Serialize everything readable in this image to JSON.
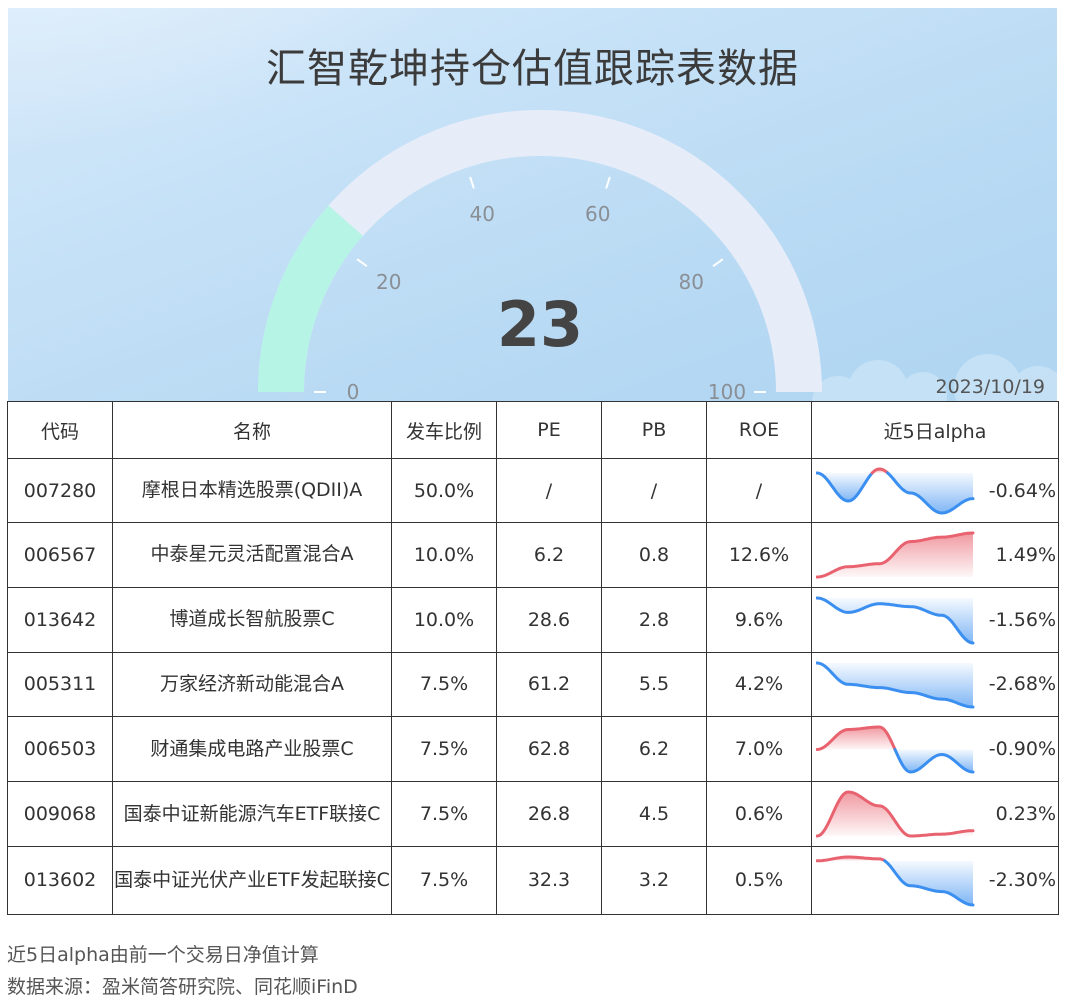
{
  "title": "汇智乾坤持仓估值跟踪表数据",
  "date": "2023/10/19",
  "gauge": {
    "value": 23,
    "min": 0,
    "max": 100,
    "ticks": [
      "0",
      "20",
      "40",
      "60",
      "80",
      "100"
    ],
    "fill_color": "#b6f4e6",
    "track_color": "#e6ecf8"
  },
  "table": {
    "headers": [
      "代码",
      "名称",
      "发车比例",
      "PE",
      "PB",
      "ROE",
      "近5日alpha"
    ],
    "rows": [
      {
        "code": "007280",
        "name": "摩根日本精选股票(QDII)A",
        "ratio": "50.0%",
        "pe": "/",
        "pb": "/",
        "roe": "/",
        "alpha": "-0.64%"
      },
      {
        "code": "006567",
        "name": "中泰星元灵活配置混合A",
        "ratio": "10.0%",
        "pe": "6.2",
        "pb": "0.8",
        "roe": "12.6%",
        "alpha": "1.49%"
      },
      {
        "code": "013642",
        "name": "博道成长智航股票C",
        "ratio": "10.0%",
        "pe": "28.6",
        "pb": "2.8",
        "roe": "9.6%",
        "alpha": "-1.56%"
      },
      {
        "code": "005311",
        "name": "万家经济新动能混合A",
        "ratio": "7.5%",
        "pe": "61.2",
        "pb": "5.5",
        "roe": "4.2%",
        "alpha": "-2.68%"
      },
      {
        "code": "006503",
        "name": "财通集成电路产业股票C",
        "ratio": "7.5%",
        "pe": "62.8",
        "pb": "6.2",
        "roe": "7.0%",
        "alpha": "-0.90%"
      },
      {
        "code": "009068",
        "name": "国泰中证新能源汽车ETF联接C",
        "ratio": "7.5%",
        "pe": "26.8",
        "pb": "4.5",
        "roe": "0.6%",
        "alpha": "0.23%"
      },
      {
        "code": "013602",
        "name": "国泰中证光伏产业ETF发起联接C",
        "ratio": "7.5%",
        "pe": "32.3",
        "pb": "3.2",
        "roe": "0.5%",
        "alpha": "-2.30%"
      }
    ]
  },
  "chart_data": [
    {
      "type": "gauge",
      "title": "汇智乾坤持仓估值跟踪表数据",
      "value": 23,
      "range": [
        0,
        100
      ],
      "ticks": [
        0,
        20,
        40,
        60,
        80,
        100
      ]
    },
    {
      "type": "area",
      "series": [
        {
          "values": [
            0.0,
            -0.7,
            0.1,
            -0.5,
            -1.0,
            -0.64
          ],
          "color_pos": "#e8636f",
          "color_neg": "#3b8ff0"
        },
        {
          "values": [
            0.0,
            0.35,
            0.45,
            1.2,
            1.35,
            1.49
          ],
          "color_pos": "#e8636f",
          "color_neg": "#3b8ff0"
        },
        {
          "values": [
            0.0,
            -0.5,
            -0.2,
            -0.3,
            -0.6,
            -1.56
          ],
          "color_pos": "#e8636f",
          "color_neg": "#3b8ff0"
        },
        {
          "values": [
            0.0,
            -1.3,
            -1.5,
            -1.8,
            -2.2,
            -2.68
          ],
          "color_pos": "#e8636f",
          "color_neg": "#3b8ff0"
        },
        {
          "values": [
            0.0,
            0.8,
            0.9,
            -0.9,
            -0.2,
            -0.9
          ],
          "color_pos": "#e8636f",
          "color_neg": "#3b8ff0"
        },
        {
          "values": [
            0.0,
            1.9,
            1.3,
            0.0,
            0.08,
            0.23
          ],
          "color_pos": "#e8636f",
          "color_neg": "#3b8ff0"
        },
        {
          "values": [
            0.0,
            0.2,
            0.1,
            -1.3,
            -1.6,
            -2.3
          ],
          "color_pos": "#e8636f",
          "color_neg": "#3b8ff0"
        }
      ]
    }
  ],
  "footer": {
    "note": "近5日alpha由前一个交易日净值计算",
    "source": "数据来源：盈米简答研究院、同花顺iFinD"
  }
}
